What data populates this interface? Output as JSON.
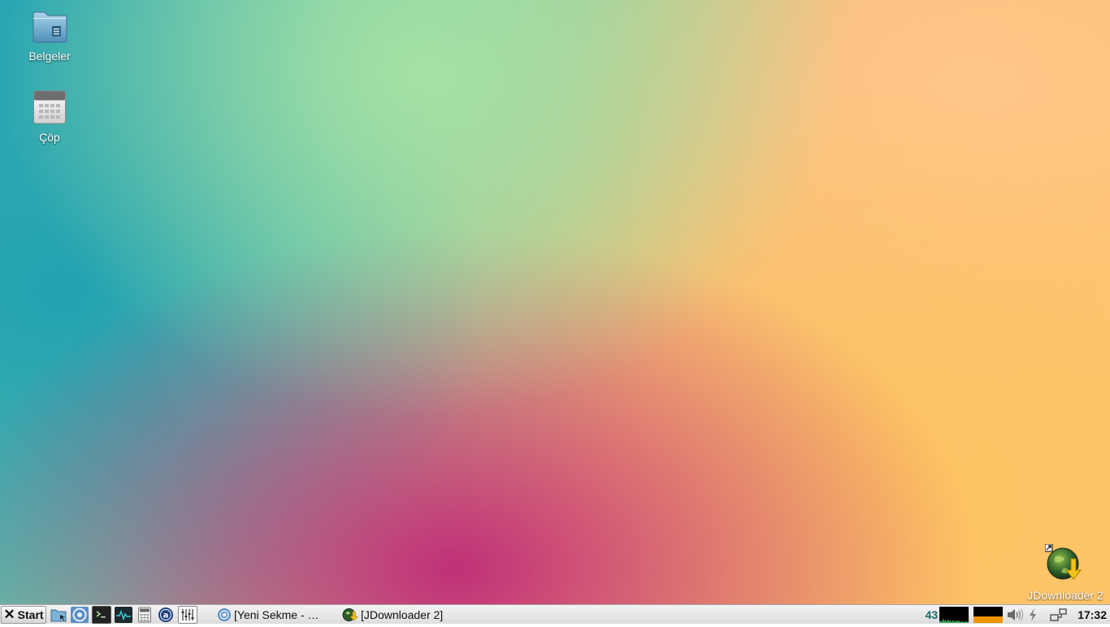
{
  "desktop": {
    "icons": [
      {
        "label": "Belgeler",
        "icon": "folder-documents-icon"
      },
      {
        "label": "Çöp",
        "icon": "trash-icon"
      },
      {
        "label": "JDownloader 2",
        "icon": "jdownloader-icon"
      }
    ]
  },
  "taskbar": {
    "start_label": "Start",
    "launchers": [
      "file-manager-icon",
      "chromium-icon",
      "terminal-icon",
      "system-monitor-icon",
      "calculator-icon",
      "app-a-icon",
      "mixer-icon"
    ],
    "tasks": [
      {
        "label": "[Yeni Sekme - …",
        "icon": "chromium-icon"
      },
      {
        "label": "[JDownloader 2]",
        "icon": "jdownloader-icon"
      }
    ]
  },
  "tray": {
    "cpu_value": "43",
    "battery_level": 1.0,
    "clock": "17:32",
    "icons": [
      "volume-icon",
      "power-icon",
      "network-icon"
    ]
  },
  "colors": {
    "taskbar_bg": "#e6e6e6",
    "battery_fill": "#f29400",
    "cpu_text": "#1a6a6a"
  }
}
